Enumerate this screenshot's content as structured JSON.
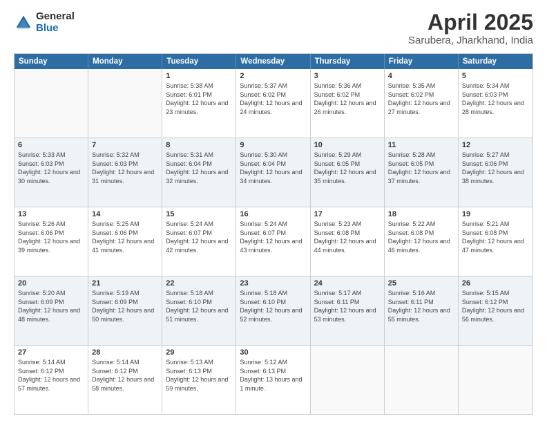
{
  "logo": {
    "general": "General",
    "blue": "Blue"
  },
  "title": {
    "month": "April 2025",
    "location": "Sarubera, Jharkhand, India"
  },
  "calendar": {
    "headers": [
      "Sunday",
      "Monday",
      "Tuesday",
      "Wednesday",
      "Thursday",
      "Friday",
      "Saturday"
    ],
    "rows": [
      [
        {
          "date": "",
          "sunrise": "",
          "sunset": "",
          "daylight": "",
          "empty": true
        },
        {
          "date": "",
          "sunrise": "",
          "sunset": "",
          "daylight": "",
          "empty": true
        },
        {
          "date": "1",
          "sunrise": "Sunrise: 5:38 AM",
          "sunset": "Sunset: 6:01 PM",
          "daylight": "Daylight: 12 hours and 23 minutes.",
          "empty": false
        },
        {
          "date": "2",
          "sunrise": "Sunrise: 5:37 AM",
          "sunset": "Sunset: 6:02 PM",
          "daylight": "Daylight: 12 hours and 24 minutes.",
          "empty": false
        },
        {
          "date": "3",
          "sunrise": "Sunrise: 5:36 AM",
          "sunset": "Sunset: 6:02 PM",
          "daylight": "Daylight: 12 hours and 26 minutes.",
          "empty": false
        },
        {
          "date": "4",
          "sunrise": "Sunrise: 5:35 AM",
          "sunset": "Sunset: 6:02 PM",
          "daylight": "Daylight: 12 hours and 27 minutes.",
          "empty": false
        },
        {
          "date": "5",
          "sunrise": "Sunrise: 5:34 AM",
          "sunset": "Sunset: 6:03 PM",
          "daylight": "Daylight: 12 hours and 28 minutes.",
          "empty": false
        }
      ],
      [
        {
          "date": "6",
          "sunrise": "Sunrise: 5:33 AM",
          "sunset": "Sunset: 6:03 PM",
          "daylight": "Daylight: 12 hours and 30 minutes.",
          "empty": false
        },
        {
          "date": "7",
          "sunrise": "Sunrise: 5:32 AM",
          "sunset": "Sunset: 6:03 PM",
          "daylight": "Daylight: 12 hours and 31 minutes.",
          "empty": false
        },
        {
          "date": "8",
          "sunrise": "Sunrise: 5:31 AM",
          "sunset": "Sunset: 6:04 PM",
          "daylight": "Daylight: 12 hours and 32 minutes.",
          "empty": false
        },
        {
          "date": "9",
          "sunrise": "Sunrise: 5:30 AM",
          "sunset": "Sunset: 6:04 PM",
          "daylight": "Daylight: 12 hours and 34 minutes.",
          "empty": false
        },
        {
          "date": "10",
          "sunrise": "Sunrise: 5:29 AM",
          "sunset": "Sunset: 6:05 PM",
          "daylight": "Daylight: 12 hours and 35 minutes.",
          "empty": false
        },
        {
          "date": "11",
          "sunrise": "Sunrise: 5:28 AM",
          "sunset": "Sunset: 6:05 PM",
          "daylight": "Daylight: 12 hours and 37 minutes.",
          "empty": false
        },
        {
          "date": "12",
          "sunrise": "Sunrise: 5:27 AM",
          "sunset": "Sunset: 6:06 PM",
          "daylight": "Daylight: 12 hours and 38 minutes.",
          "empty": false
        }
      ],
      [
        {
          "date": "13",
          "sunrise": "Sunrise: 5:26 AM",
          "sunset": "Sunset: 6:06 PM",
          "daylight": "Daylight: 12 hours and 39 minutes.",
          "empty": false
        },
        {
          "date": "14",
          "sunrise": "Sunrise: 5:25 AM",
          "sunset": "Sunset: 6:06 PM",
          "daylight": "Daylight: 12 hours and 41 minutes.",
          "empty": false
        },
        {
          "date": "15",
          "sunrise": "Sunrise: 5:24 AM",
          "sunset": "Sunset: 6:07 PM",
          "daylight": "Daylight: 12 hours and 42 minutes.",
          "empty": false
        },
        {
          "date": "16",
          "sunrise": "Sunrise: 5:24 AM",
          "sunset": "Sunset: 6:07 PM",
          "daylight": "Daylight: 12 hours and 43 minutes.",
          "empty": false
        },
        {
          "date": "17",
          "sunrise": "Sunrise: 5:23 AM",
          "sunset": "Sunset: 6:08 PM",
          "daylight": "Daylight: 12 hours and 44 minutes.",
          "empty": false
        },
        {
          "date": "18",
          "sunrise": "Sunrise: 5:22 AM",
          "sunset": "Sunset: 6:08 PM",
          "daylight": "Daylight: 12 hours and 46 minutes.",
          "empty": false
        },
        {
          "date": "19",
          "sunrise": "Sunrise: 5:21 AM",
          "sunset": "Sunset: 6:08 PM",
          "daylight": "Daylight: 12 hours and 47 minutes.",
          "empty": false
        }
      ],
      [
        {
          "date": "20",
          "sunrise": "Sunrise: 5:20 AM",
          "sunset": "Sunset: 6:09 PM",
          "daylight": "Daylight: 12 hours and 48 minutes.",
          "empty": false
        },
        {
          "date": "21",
          "sunrise": "Sunrise: 5:19 AM",
          "sunset": "Sunset: 6:09 PM",
          "daylight": "Daylight: 12 hours and 50 minutes.",
          "empty": false
        },
        {
          "date": "22",
          "sunrise": "Sunrise: 5:18 AM",
          "sunset": "Sunset: 6:10 PM",
          "daylight": "Daylight: 12 hours and 51 minutes.",
          "empty": false
        },
        {
          "date": "23",
          "sunrise": "Sunrise: 5:18 AM",
          "sunset": "Sunset: 6:10 PM",
          "daylight": "Daylight: 12 hours and 52 minutes.",
          "empty": false
        },
        {
          "date": "24",
          "sunrise": "Sunrise: 5:17 AM",
          "sunset": "Sunset: 6:11 PM",
          "daylight": "Daylight: 12 hours and 53 minutes.",
          "empty": false
        },
        {
          "date": "25",
          "sunrise": "Sunrise: 5:16 AM",
          "sunset": "Sunset: 6:11 PM",
          "daylight": "Daylight: 12 hours and 55 minutes.",
          "empty": false
        },
        {
          "date": "26",
          "sunrise": "Sunrise: 5:15 AM",
          "sunset": "Sunset: 6:12 PM",
          "daylight": "Daylight: 12 hours and 56 minutes.",
          "empty": false
        }
      ],
      [
        {
          "date": "27",
          "sunrise": "Sunrise: 5:14 AM",
          "sunset": "Sunset: 6:12 PM",
          "daylight": "Daylight: 12 hours and 57 minutes.",
          "empty": false
        },
        {
          "date": "28",
          "sunrise": "Sunrise: 5:14 AM",
          "sunset": "Sunset: 6:12 PM",
          "daylight": "Daylight: 12 hours and 58 minutes.",
          "empty": false
        },
        {
          "date": "29",
          "sunrise": "Sunrise: 5:13 AM",
          "sunset": "Sunset: 6:13 PM",
          "daylight": "Daylight: 12 hours and 59 minutes.",
          "empty": false
        },
        {
          "date": "30",
          "sunrise": "Sunrise: 5:12 AM",
          "sunset": "Sunset: 6:13 PM",
          "daylight": "Daylight: 13 hours and 1 minute.",
          "empty": false
        },
        {
          "date": "",
          "sunrise": "",
          "sunset": "",
          "daylight": "",
          "empty": true
        },
        {
          "date": "",
          "sunrise": "",
          "sunset": "",
          "daylight": "",
          "empty": true
        },
        {
          "date": "",
          "sunrise": "",
          "sunset": "",
          "daylight": "",
          "empty": true
        }
      ]
    ]
  }
}
